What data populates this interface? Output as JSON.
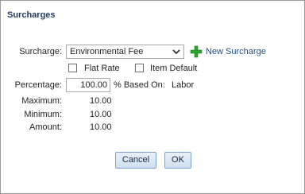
{
  "dialog": {
    "title": "Surcharges",
    "surcharge_label": "Surcharge:",
    "surcharge_value": "Environmental Fee",
    "new_surcharge": "New Surcharge",
    "flat_rate_label": "Flat Rate",
    "item_default_label": "Item Default",
    "percentage_label": "Percentage:",
    "percentage_value": "100.00",
    "based_on_label": "% Based On:",
    "based_on_value": "Labor",
    "maximum_label": "Maximum:",
    "maximum_value": "10.00",
    "minimum_label": "Minimum:",
    "minimum_value": "10.00",
    "amount_label": "Amount:",
    "amount_value": "10.00",
    "cancel_label": "Cancel",
    "ok_label": "OK"
  },
  "icons": {
    "add": "plus-icon",
    "dropdown": "chevron-down-icon"
  },
  "colors": {
    "title": "#1f3a5a",
    "link": "#1f4f8a",
    "plus": "#2fa52f",
    "button_border": "#7fa1c4"
  },
  "checkboxes": {
    "flat_rate_checked": false,
    "item_default_checked": false
  }
}
